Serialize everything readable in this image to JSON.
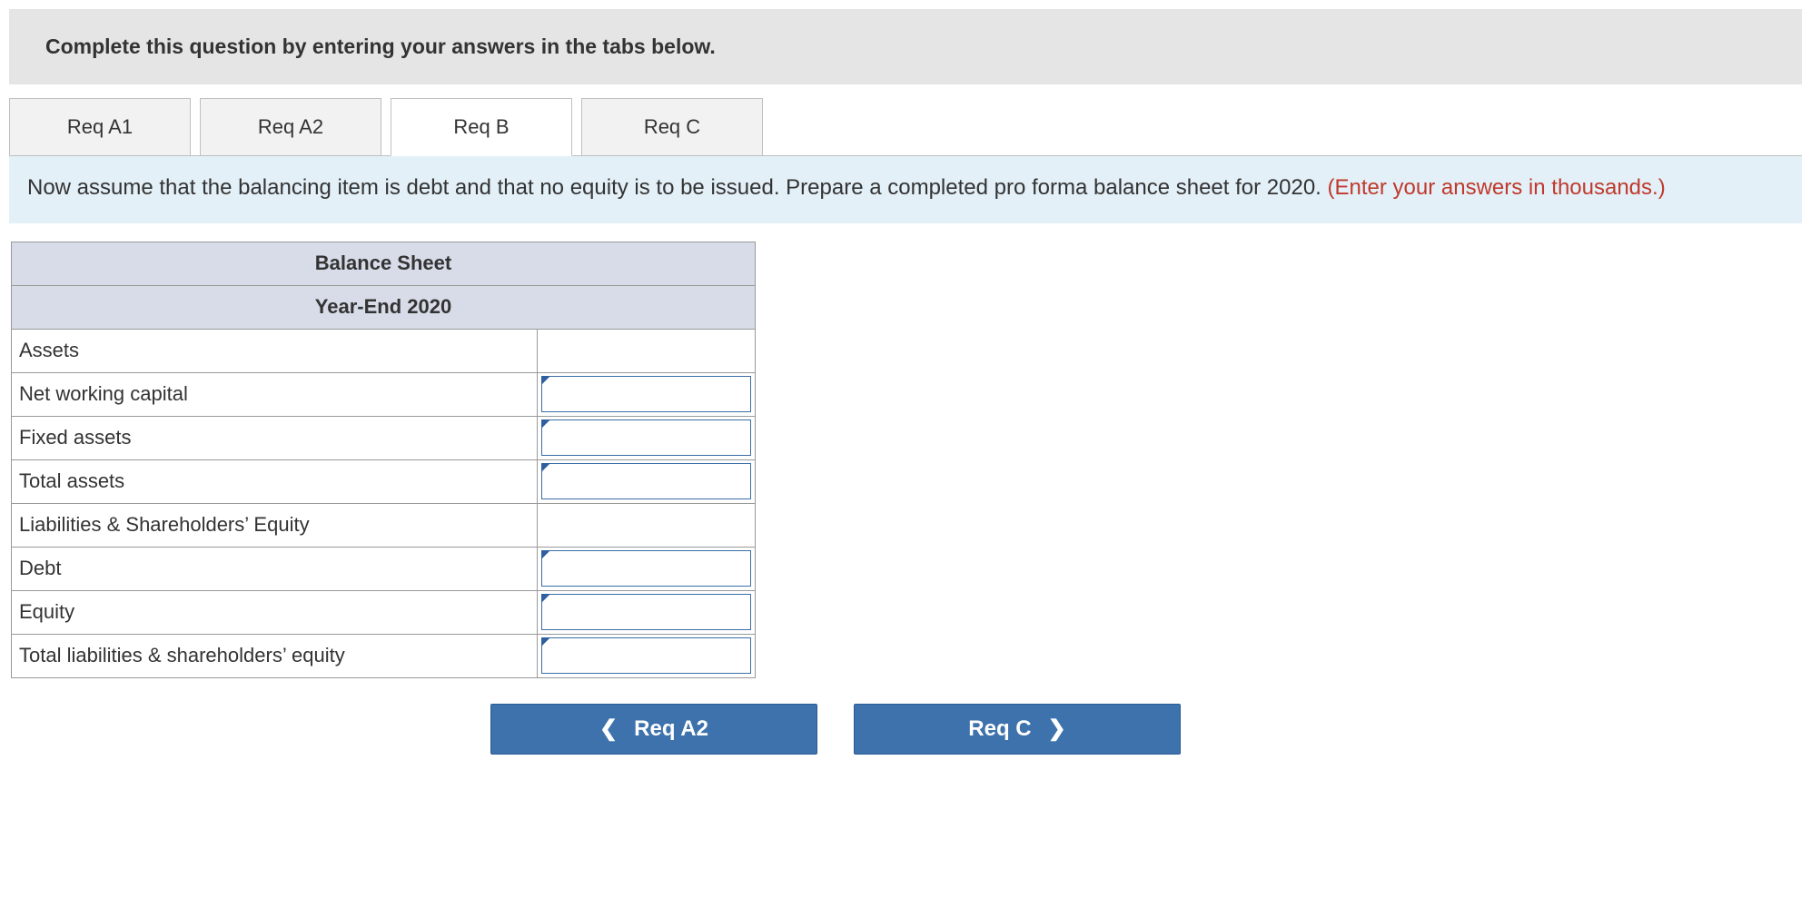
{
  "instruction": "Complete this question by entering your answers in the tabs below.",
  "tabs": [
    {
      "label": "Req A1",
      "active": false
    },
    {
      "label": "Req A2",
      "active": false
    },
    {
      "label": "Req B",
      "active": true
    },
    {
      "label": "Req C",
      "active": false
    }
  ],
  "question": {
    "main": "Now assume that the balancing item is debt and that no equity is to be issued. Prepare a completed pro forma balance sheet for 2020. ",
    "hint": "(Enter your answers in thousands.)"
  },
  "balance_sheet": {
    "title": "Balance Sheet",
    "subtitle": "Year-End 2020",
    "rows": [
      {
        "label": "Assets",
        "has_input": false
      },
      {
        "label": "Net working capital",
        "has_input": true
      },
      {
        "label": "Fixed assets",
        "has_input": true
      },
      {
        "label": "Total assets",
        "has_input": true
      },
      {
        "label": "Liabilities & Shareholders’ Equity",
        "has_input": false
      },
      {
        "label": "Debt",
        "has_input": true
      },
      {
        "label": "Equity",
        "has_input": true
      },
      {
        "label": "Total liabilities & shareholders’ equity",
        "has_input": true
      }
    ]
  },
  "nav": {
    "prev_label": "Req A2",
    "next_label": "Req C"
  }
}
